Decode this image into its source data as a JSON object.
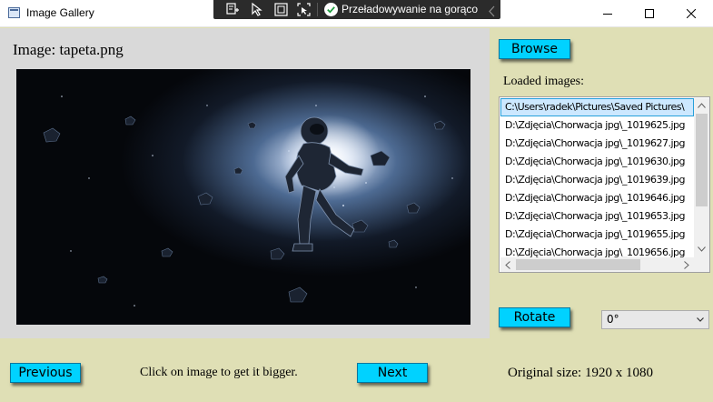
{
  "window": {
    "title": "Image Gallery",
    "hot_reload_label": "Przeładowywanie na gorąco"
  },
  "image_panel": {
    "caption": "Image: tapeta.png",
    "preview_icon": "astronaut-wallpaper"
  },
  "sidebar": {
    "browse_label": "Browse",
    "loaded_label": "Loaded images:",
    "images": [
      "C:\\Users\\radek\\Pictures\\Saved Pictures\\",
      "D:\\Zdjęcia\\Chorwacja jpg\\_1019625.jpg",
      "D:\\Zdjęcia\\Chorwacja jpg\\_1019627.jpg",
      "D:\\Zdjęcia\\Chorwacja jpg\\_1019630.jpg",
      "D:\\Zdjęcia\\Chorwacja jpg\\_1019639.jpg",
      "D:\\Zdjęcia\\Chorwacja jpg\\_1019646.jpg",
      "D:\\Zdjęcia\\Chorwacja jpg\\_1019653.jpg",
      "D:\\Zdjęcia\\Chorwacja jpg\\_1019655.jpg",
      "D:\\Zdjęcia\\Chorwacja jpg\\_1019656.jpg"
    ],
    "selected_index": 0,
    "rotate_label": "Rotate",
    "rotation_value": "0°"
  },
  "footer": {
    "previous_label": "Previous",
    "hint": "Click on image to get it bigger.",
    "next_label": "Next",
    "original_size": "Original size: 1920 x 1080"
  },
  "colors": {
    "background": "#dfdfb5",
    "button": "#00d2ff",
    "selection": "#cce8ff"
  }
}
